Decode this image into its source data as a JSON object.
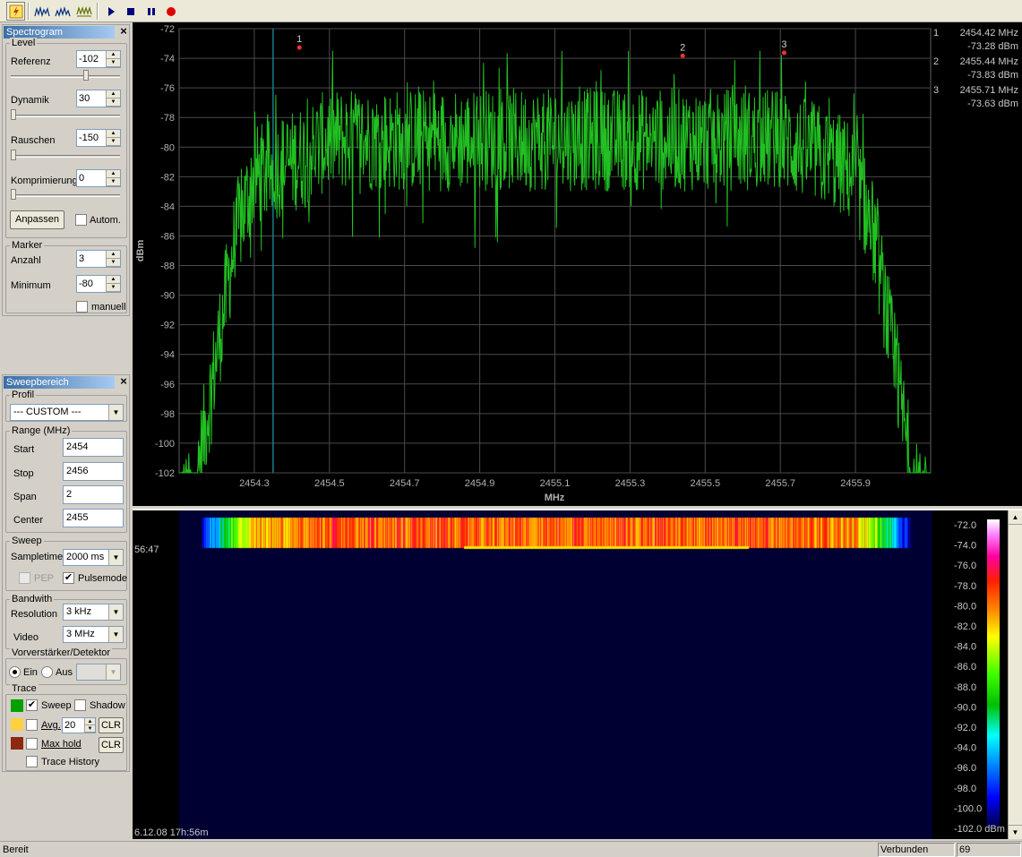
{
  "toolbar": {
    "buttons": [
      {
        "name": "lightning-icon"
      },
      {
        "name": "sweep-mode-1-icon"
      },
      {
        "name": "sweep-mode-2-icon"
      },
      {
        "name": "sweep-mode-3-icon"
      },
      {
        "name": "play-icon"
      },
      {
        "name": "stop-icon"
      },
      {
        "name": "pause-icon"
      },
      {
        "name": "record-icon"
      }
    ]
  },
  "spectrogram_panel": {
    "title": "Spectrogram",
    "level_group": "Level",
    "referenz_label": "Referenz",
    "referenz_value": "-102",
    "referenz_slider": 0.7,
    "dynamik_label": "Dynamik",
    "dynamik_value": "30",
    "dynamik_slider": 0.0,
    "rauschen_label": "Rauschen",
    "rauschen_value": "-150",
    "rauschen_slider": 0.0,
    "komprimierung_label": "Komprimierung",
    "komprimierung_value": "0",
    "komprimierung_slider": 0.0,
    "anpassen_button": "Anpassen",
    "autom_label": "Autom.",
    "autom_checked": false,
    "marker_group": "Marker",
    "anzahl_label": "Anzahl",
    "anzahl_value": "3",
    "minimum_label": "Minimum",
    "minimum_value": "-80",
    "manuell_label": "manuell",
    "manuell_checked": false
  },
  "sweep_panel": {
    "title": "Sweepbereich",
    "profil_group": "Profil",
    "profil_value": "--- CUSTOM ---",
    "range_group": "Range (MHz)",
    "start_label": "Start",
    "start_value": "2454",
    "stop_label": "Stop",
    "stop_value": "2456",
    "span_label": "Span",
    "span_value": "2",
    "center_label": "Center",
    "center_value": "2455",
    "sweep_group": "Sweep",
    "sampletime_label": "Sampletime",
    "sampletime_value": "2000 ms",
    "pep_label": "PEP",
    "pulsemode_label": "Pulsemode",
    "pulsemode_checked": true,
    "bandwith_group": "Bandwith",
    "resolution_label": "Resolution",
    "resolution_value": "3 kHz",
    "video_label": "Video",
    "video_value": "3 MHz",
    "vorverstaerker_group": "Vorverstärker/Detektor",
    "ein_label": "Ein",
    "aus_label": "Aus",
    "trace_group": "Trace",
    "sweep_label": "Sweep",
    "sweep_color": "#00a000",
    "shadow_label": "Shadow",
    "avg_label": "Avg.",
    "avg_value": "20",
    "avg_color": "#ffd040",
    "clr_label": "CLR",
    "maxhold_label": "Max hold",
    "maxhold_color": "#8b2a10",
    "tracehistory_label": "Trace History"
  },
  "chart_data": {
    "type": "line",
    "xlabel": "MHz",
    "ylabel": "dBm",
    "xlim": [
      2454.1,
      2456.1
    ],
    "ylim": [
      -102,
      -72
    ],
    "xticks": [
      "2454.3",
      "2454.5",
      "2454.7",
      "2454.9",
      "2455.1",
      "2455.3",
      "2455.5",
      "2455.7",
      "2455.9"
    ],
    "yticks": [
      "-72",
      "-74",
      "-76",
      "-78",
      "-80",
      "-82",
      "-84",
      "-86",
      "-88",
      "-90",
      "-92",
      "-94",
      "-96",
      "-98",
      "-100",
      "-102"
    ],
    "grid": true,
    "series_color": "#22c022",
    "cursor_mhz": 2454.35,
    "band_shape": {
      "x": [
        2454.15,
        2454.2,
        2454.25,
        2454.3,
        2454.4,
        2454.5,
        2455.1,
        2455.7,
        2455.85,
        2455.9,
        2455.95,
        2456.0,
        2456.05
      ],
      "y": [
        -102,
        -94,
        -86,
        -82,
        -81,
        -79.5,
        -79.5,
        -79.5,
        -81,
        -82,
        -86,
        -94,
        -102
      ]
    },
    "markers": [
      {
        "label": "1",
        "x": 2454.42,
        "y": -73.28
      },
      {
        "label": "2",
        "x": 2455.44,
        "y": -73.83
      },
      {
        "label": "3",
        "x": 2455.71,
        "y": -73.63
      }
    ]
  },
  "markers_readout": [
    {
      "index": "1",
      "freq": "2454.42 MHz",
      "level": "-73.28 dBm"
    },
    {
      "index": "2",
      "freq": "2455.44 MHz",
      "level": "-73.83 dBm"
    },
    {
      "index": "3",
      "freq": "2455.71 MHz",
      "level": "-73.63 dBm"
    }
  ],
  "waterfall": {
    "time_top": "56:47",
    "time_bottom": "6.12.08 17h:56m",
    "background": "#000033",
    "colorbar_ticks": [
      "-72.0",
      "-74.0",
      "-76.0",
      "-78.0",
      "-80.0",
      "-82.0",
      "-84.0",
      "-86.0",
      "-88.0",
      "-90.0",
      "-92.0",
      "-94.0",
      "-96.0",
      "-98.0",
      "-100.0",
      "-102.0 dBm"
    ]
  },
  "statusbar": {
    "left": "Bereit",
    "middle": "Verbunden",
    "right": "69"
  }
}
